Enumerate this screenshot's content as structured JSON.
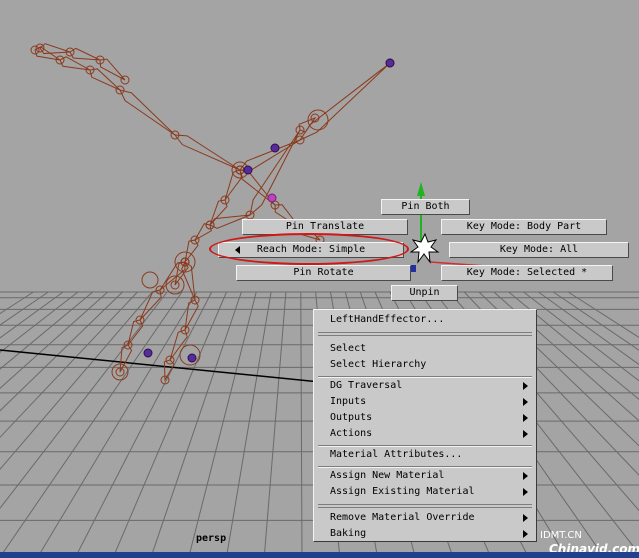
{
  "viewport": {
    "camera_label": "persp"
  },
  "marking_menu": {
    "north": "Pin Both",
    "north_west": "Pin Translate",
    "west": "Reach Mode: Simple",
    "south_west": "Pin Rotate",
    "south": "Unpin",
    "north_east": "Key Mode: Body Part",
    "east": "Key Mode: All",
    "south_east": "Key Mode: Selected *"
  },
  "context_menu": {
    "title": "LeftHandEffector...",
    "groups": [
      [
        "Select",
        "Select Hierarchy"
      ],
      [
        "DG Traversal",
        "Inputs",
        "Outputs",
        "Actions"
      ],
      [
        "Material Attributes..."
      ],
      [
        "Assign New Material",
        "Assign Existing Material"
      ],
      [
        "Remove Material Override",
        "Baking"
      ]
    ]
  },
  "colors": {
    "skeleton": "#8a3a1c",
    "highlight_oval": "#d01818",
    "grid": "#666666",
    "menu_bg": "#c9c9c9",
    "background": "#a4a4a4"
  },
  "watermark": {
    "line1": "IDMT.CN",
    "line2": "Chinavid.com"
  }
}
